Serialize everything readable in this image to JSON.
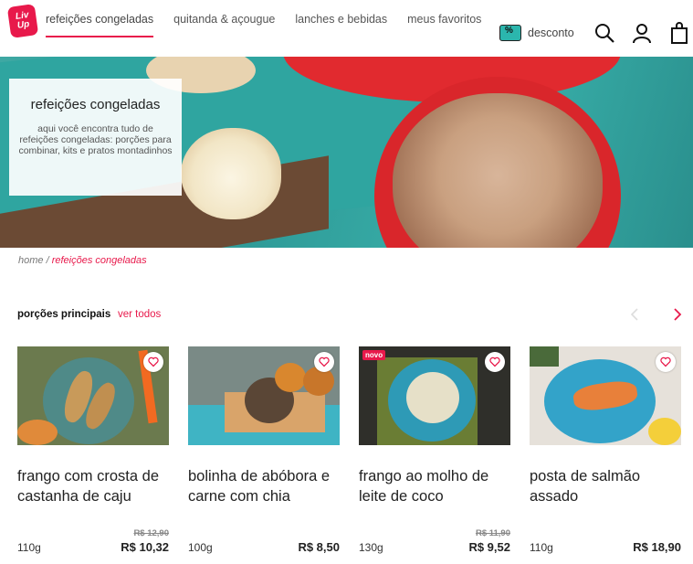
{
  "logo": {
    "text": "Liv Up"
  },
  "nav": [
    {
      "label": "refeições congeladas",
      "active": true
    },
    {
      "label": "quitanda & açougue",
      "active": false
    },
    {
      "label": "lanches e bebidas",
      "active": false
    },
    {
      "label": "meus favoritos",
      "active": false
    }
  ],
  "header": {
    "discount_label": "desconto"
  },
  "banner": {
    "title": "refeições congeladas",
    "description": "aqui você encontra tudo de refeições congeladas: porções para combinar, kits e pratos montadinhos"
  },
  "breadcrumb": {
    "home": "home",
    "separator": " / ",
    "current": "refeições congeladas"
  },
  "section": {
    "title": "porções principais",
    "see_all": "ver todos"
  },
  "products": [
    {
      "name": "frango com crosta de castanha de caju",
      "weight": "110g",
      "old_price": "R$ 12,90",
      "price": "R$ 10,32",
      "badge": ""
    },
    {
      "name": "bolinha de abóbora e carne com chia",
      "weight": "100g",
      "old_price": "",
      "price": "R$ 8,50",
      "badge": ""
    },
    {
      "name": "frango ao molho de leite de coco",
      "weight": "130g",
      "old_price": "R$ 11,90",
      "price": "R$ 9,52",
      "badge": "novo"
    },
    {
      "name": "posta de salmão assado",
      "weight": "110g",
      "old_price": "",
      "price": "R$ 18,90",
      "badge": ""
    }
  ],
  "colors": {
    "accent": "#e8194b",
    "teal": "#2bb6ad"
  }
}
